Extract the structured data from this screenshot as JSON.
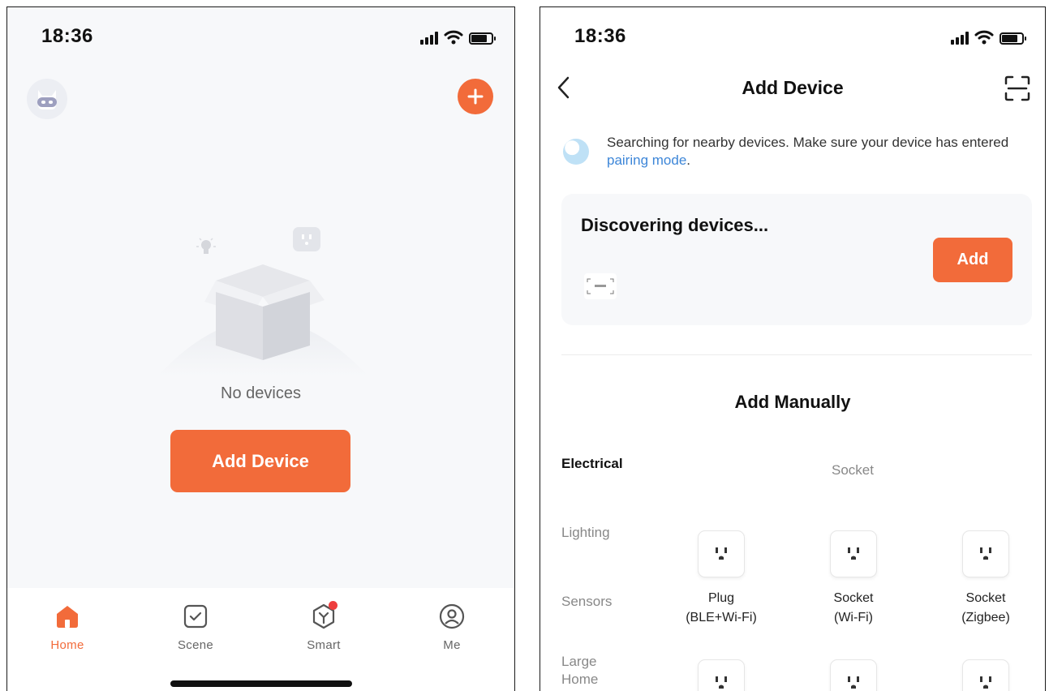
{
  "left": {
    "status": {
      "time": "18:36"
    },
    "empty_text": "No devices",
    "add_device_label": "Add Device",
    "tabs": [
      {
        "label": "Home",
        "icon": "home-icon"
      },
      {
        "label": "Scene",
        "icon": "scene-icon"
      },
      {
        "label": "Smart",
        "icon": "smart-icon"
      },
      {
        "label": "Me",
        "icon": "me-icon"
      }
    ],
    "colors": {
      "accent": "#f26b3a",
      "badge": "#ee3d3d"
    }
  },
  "right": {
    "status": {
      "time": "18:36"
    },
    "header_title": "Add Device",
    "search_hint_prefix": "Searching for nearby devices. Make sure your device has entered ",
    "search_hint_link": "pairing mode",
    "search_hint_suffix": ".",
    "discover_title": "Discovering devices...",
    "card_add_label": "Add",
    "add_manually_title": "Add Manually",
    "categories": [
      "Electrical",
      "Lighting",
      "Sensors",
      "Large Home Ap..."
    ],
    "sub_category": "Socket",
    "devices": [
      {
        "line1": "Plug",
        "line2": "(BLE+Wi-Fi)"
      },
      {
        "line1": "Socket",
        "line2": "(Wi-Fi)"
      },
      {
        "line1": "Socket",
        "line2": "(Zigbee)"
      }
    ],
    "link_color": "#3d86d8"
  }
}
